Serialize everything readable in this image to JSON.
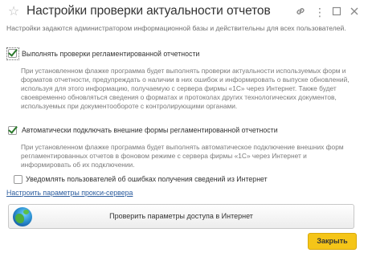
{
  "window": {
    "title": "Настройки проверки актуальности отчетов",
    "icons": {
      "favorite": "star-icon",
      "link": "link-icon",
      "more": "more-icon",
      "maximize": "maximize-icon",
      "close": "close-icon"
    }
  },
  "note": "Настройки задаются администратором информационной базы и действительны для всех пользователей.",
  "options": [
    {
      "label": "Выполнять проверки регламентированной отчетности",
      "checked": true,
      "description": "При установленном флажке программа будет выполнять проверки актуальности используемых форм и форматов отчетности, предупреждать о наличии в них ошибок и информировать о выпуске обновлений, используя для этого информацию, получаемую с сервера фирмы «1С» через Интернет. Также будет своевременно обновляться сведения о форматах и протоколах других технологических документов, используемых при документообороте с контролирующими органами."
    },
    {
      "label": "Автоматически подключать внешние формы регламентированной отчетности",
      "checked": true,
      "description": "При установленном флажке программа будет выполнять автоматическое подключение  внешних форм регламентированных отчетов в фоновом режиме с сервера фирмы «1С» через Интернет и информировать об их подключении."
    },
    {
      "label": "Уведомлять пользователей об ошибках получения сведений из Интернет",
      "checked": false
    }
  ],
  "proxy_link": "Настроить параметры прокси-сервера",
  "check_button": {
    "label": "Проверить параметры доступа в Интернет",
    "icon": "globe-icon"
  },
  "close_button": "Закрыть",
  "colors": {
    "accent_button": "#f5c518",
    "link": "#2b5c9e",
    "checkmark": "#2c7a2c"
  }
}
